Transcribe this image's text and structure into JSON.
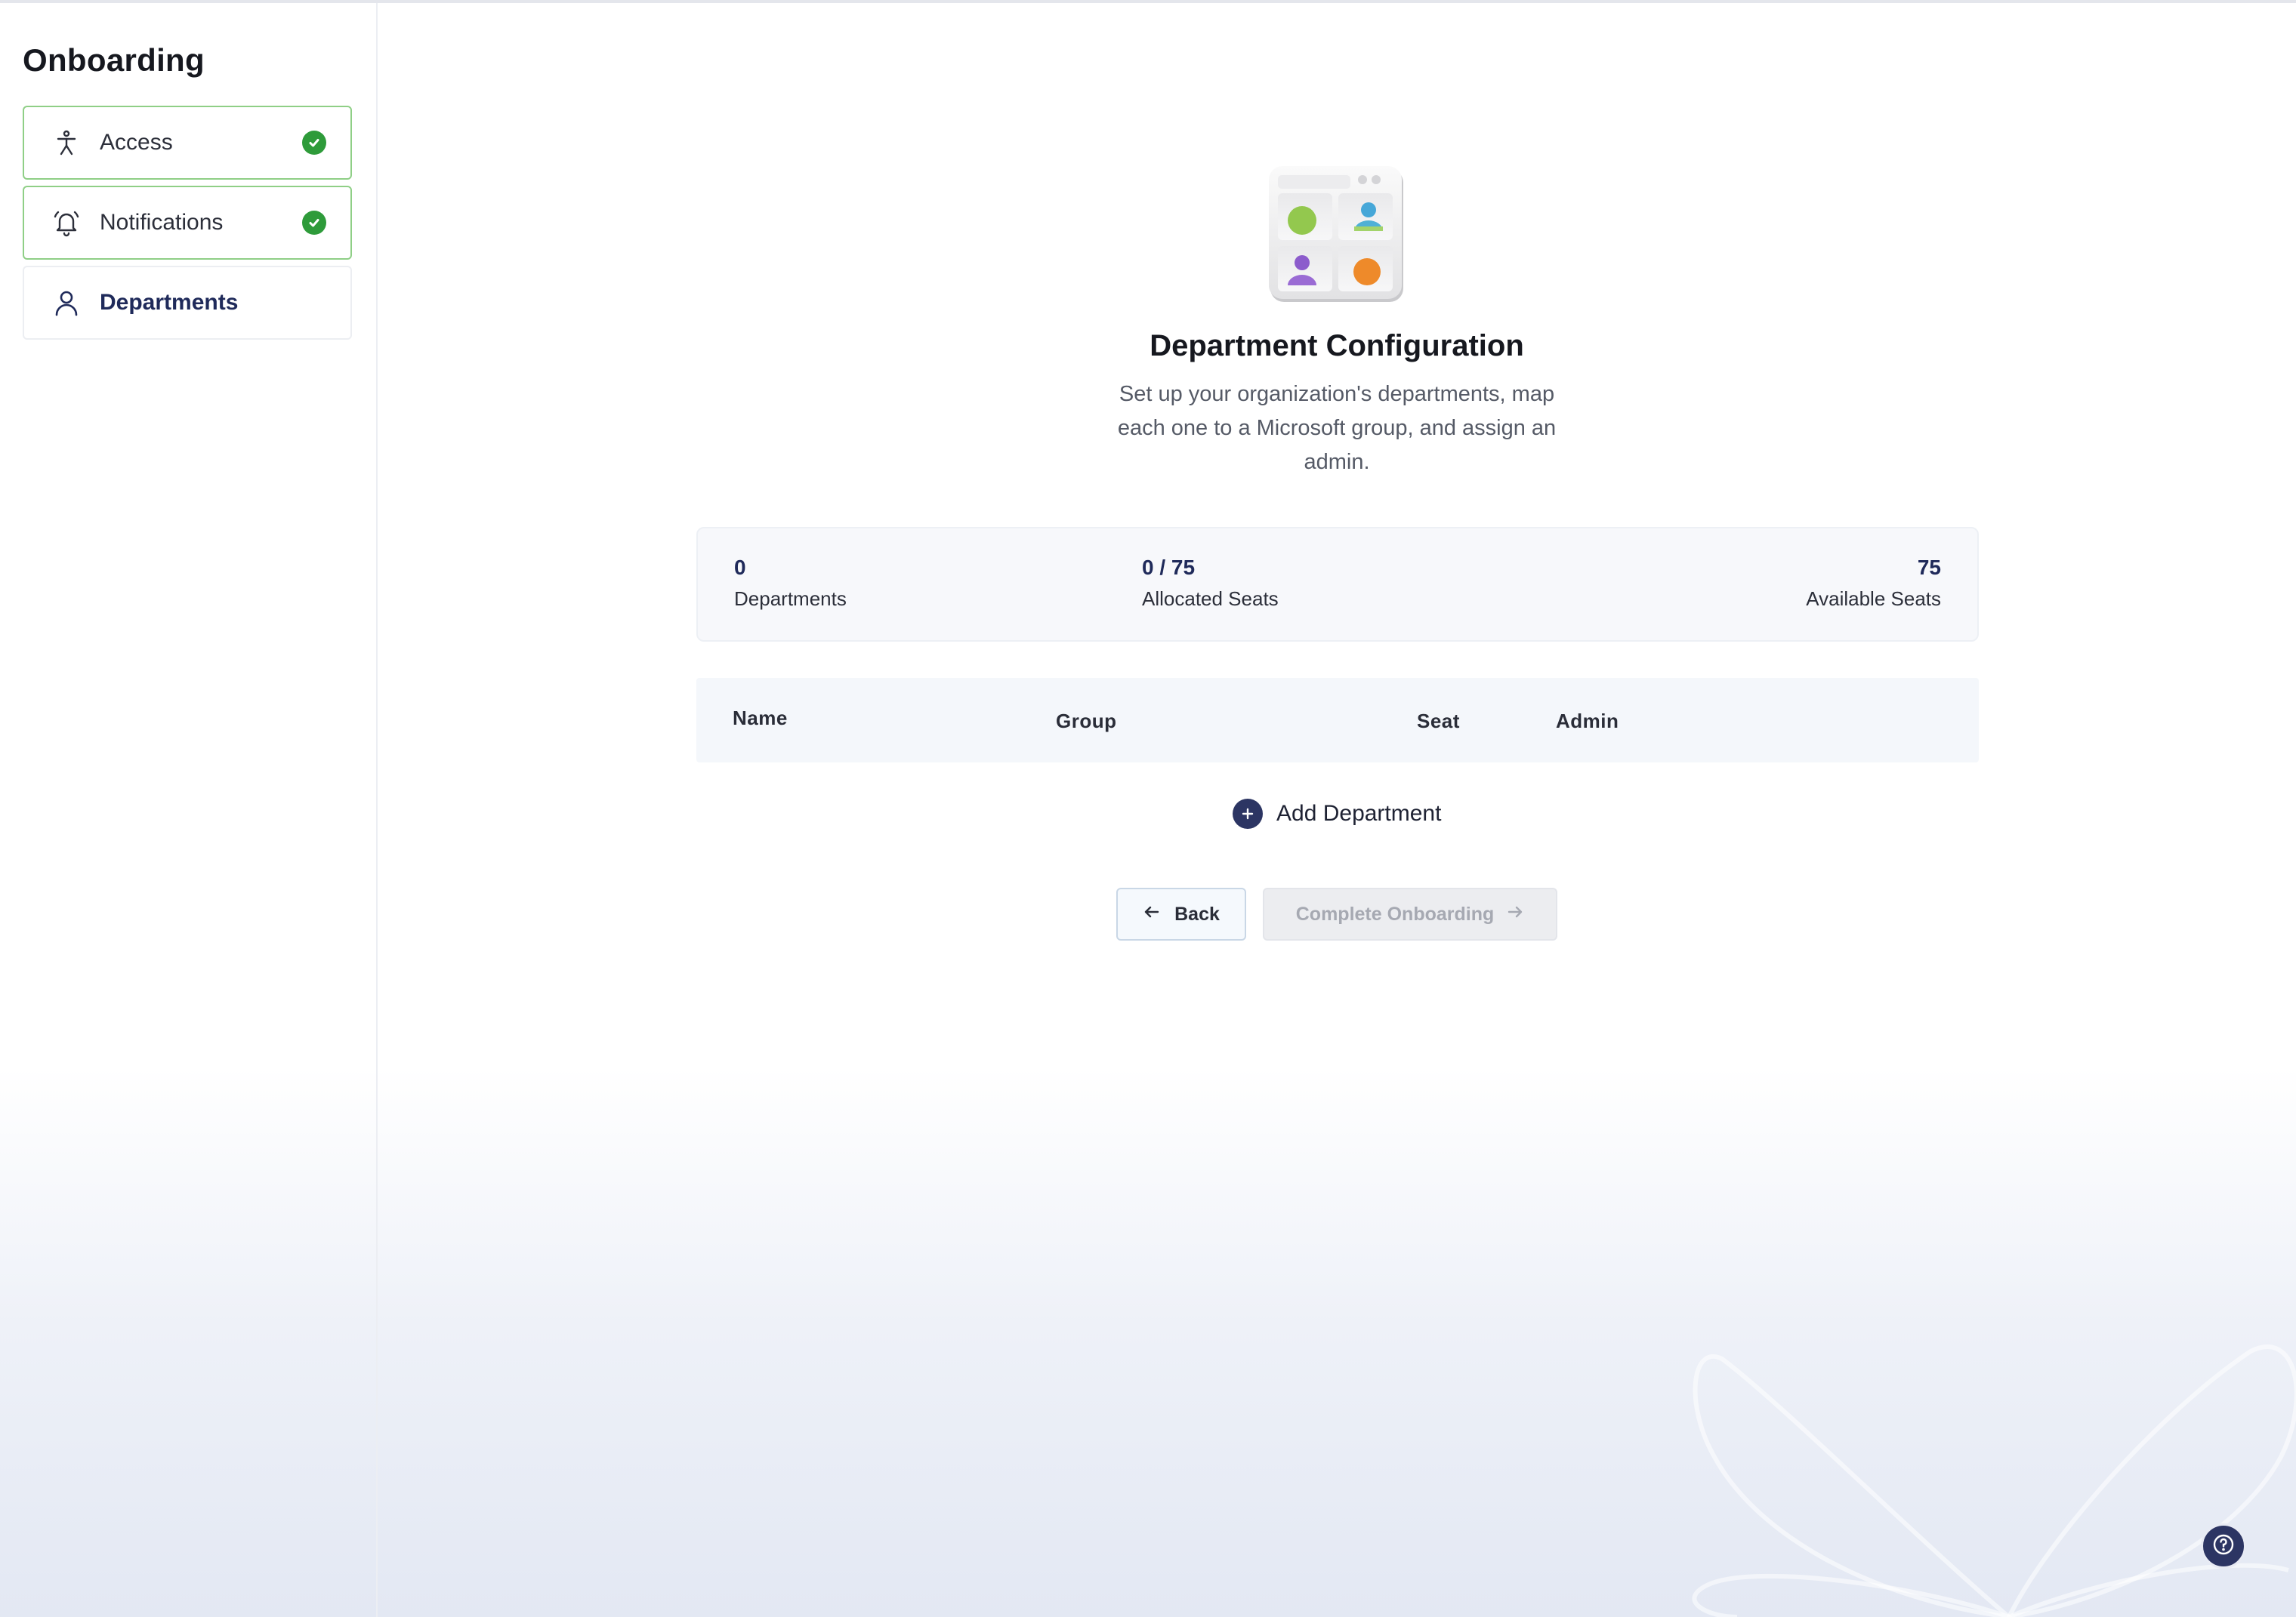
{
  "sidebar": {
    "title": "Onboarding",
    "steps": [
      {
        "label": "Access",
        "icon": "accessibility-icon",
        "status": "completed"
      },
      {
        "label": "Notifications",
        "icon": "bell-icon",
        "status": "completed"
      },
      {
        "label": "Departments",
        "icon": "user-icon",
        "status": "current"
      }
    ]
  },
  "main": {
    "title": "Department Configuration",
    "subtitle": "Set up your organization's departments, map each one to a Microsoft group, and assign an admin.",
    "stats": {
      "departments": {
        "value": "0",
        "label": "Departments"
      },
      "allocated": {
        "value": "0 / 75",
        "label": "Allocated Seats"
      },
      "available": {
        "value": "75",
        "label": "Available Seats"
      }
    },
    "table": {
      "columns": [
        "Name",
        "Group",
        "Seat",
        "Admin"
      ],
      "rows": []
    },
    "add_label": "Add Department",
    "back_label": "Back",
    "complete_label": "Complete Onboarding"
  },
  "colors": {
    "accent_navy": "#2c3563",
    "success_green": "#2e9b3a",
    "step_done_border": "#8fcf86"
  }
}
